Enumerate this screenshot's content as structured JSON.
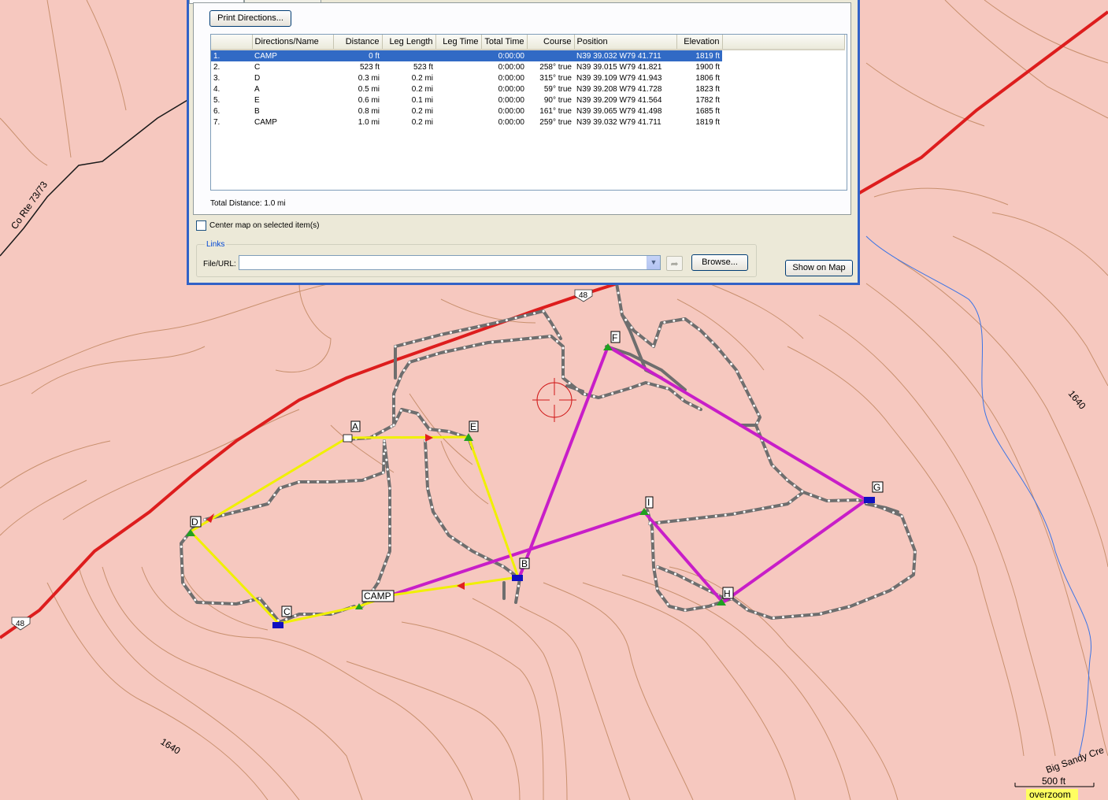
{
  "dialog": {
    "print_button": "Print Directions...",
    "columns": [
      "Directions/Name",
      "Distance",
      "Leg Length",
      "Leg Time",
      "Total Time",
      "Course",
      "Position",
      "Elevation"
    ],
    "rows": [
      {
        "num": "1.",
        "name": "CAMP",
        "distance": "0 ft",
        "leg_length": "",
        "leg_time": "",
        "total_time": "0:00:00",
        "course": "",
        "position": "N39 39.032 W79 41.711",
        "elevation": "1819 ft",
        "selected": true
      },
      {
        "num": "2.",
        "name": "C",
        "distance": "523 ft",
        "leg_length": "523 ft",
        "leg_time": "",
        "total_time": "0:00:00",
        "course": "258° true",
        "position": "N39 39.015 W79 41.821",
        "elevation": "1900 ft"
      },
      {
        "num": "3.",
        "name": "D",
        "distance": "0.3 mi",
        "leg_length": "0.2 mi",
        "leg_time": "",
        "total_time": "0:00:00",
        "course": "315° true",
        "position": "N39 39.109 W79 41.943",
        "elevation": "1806 ft"
      },
      {
        "num": "4.",
        "name": "A",
        "distance": "0.5 mi",
        "leg_length": "0.2 mi",
        "leg_time": "",
        "total_time": "0:00:00",
        "course": "59° true",
        "position": "N39 39.208 W79 41.728",
        "elevation": "1823 ft"
      },
      {
        "num": "5.",
        "name": "E",
        "distance": "0.6 mi",
        "leg_length": "0.1 mi",
        "leg_time": "",
        "total_time": "0:00:00",
        "course": "90° true",
        "position": "N39 39.209 W79 41.564",
        "elevation": "1782 ft"
      },
      {
        "num": "6.",
        "name": "B",
        "distance": "0.8 mi",
        "leg_length": "0.2 mi",
        "leg_time": "",
        "total_time": "0:00:00",
        "course": "161° true",
        "position": "N39 39.065 W79 41.498",
        "elevation": "1685 ft"
      },
      {
        "num": "7.",
        "name": "CAMP",
        "distance": "1.0 mi",
        "leg_length": "0.2 mi",
        "leg_time": "",
        "total_time": "0:00:00",
        "course": "259° true",
        "position": "N39 39.032 W79 41.711",
        "elevation": "1819 ft"
      }
    ],
    "total_distance": "Total Distance: 1.0 mi",
    "center_map_label": "Center map on selected item(s)",
    "links_legend": "Links",
    "file_url_label": "File/URL:",
    "file_url_value": "",
    "browse_button": "Browse...",
    "show_on_map_button": "Show on Map"
  },
  "map": {
    "road_label_county": "Co Rte 73/73",
    "route_shield_top": "48",
    "route_shield_left": "48",
    "contour_label_right": "1640",
    "contour_label_bottom": "1640",
    "stream_label": "Big Sandy Cre",
    "scale_text": "500 ft",
    "overzoom_text": "overzoom",
    "waypoints": [
      "A",
      "B",
      "C",
      "D",
      "E",
      "F",
      "G",
      "H",
      "I",
      "CAMP"
    ],
    "colors": {
      "background": "#f6c8bf",
      "highway": "#dd1d1d",
      "route_yellow": "#f0f000",
      "route_magenta": "#c81ec8",
      "trail": "#6e6e6e",
      "contour": "#c8906e",
      "stream": "#3b74e6"
    }
  }
}
